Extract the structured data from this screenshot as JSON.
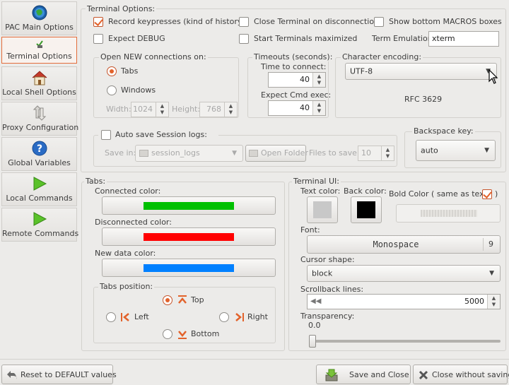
{
  "sidebar": {
    "items": [
      {
        "label": "PAC Main Options",
        "icon": "globe-icon"
      },
      {
        "label": "Terminal Options",
        "icon": "terminal-check-icon",
        "active": true
      },
      {
        "label": "Local Shell Options",
        "icon": "home-icon"
      },
      {
        "label": "Proxy Configuration",
        "icon": "proxy-arrows-icon"
      },
      {
        "label": "Global Variables",
        "icon": "help-icon"
      },
      {
        "label": "Local Commands",
        "icon": "play-icon"
      },
      {
        "label": "Remote Commands",
        "icon": "play-icon"
      }
    ]
  },
  "terminal_options": {
    "title": "Terminal Options:",
    "record_keypresses": {
      "label": "Record keypresses (kind of history)",
      "checked": true
    },
    "close_on_disconnect": {
      "label": "Close Terminal on disconnection",
      "checked": false
    },
    "show_macros": {
      "label": "Show bottom MACROS boxes",
      "checked": false
    },
    "expect_debug": {
      "label": "Expect DEBUG",
      "checked": false
    },
    "start_maximized": {
      "label": "Start Terminals maximized",
      "checked": false
    },
    "term_emulation_label": "Term Emulation:",
    "term_emulation_value": "xterm"
  },
  "open_new": {
    "title": "Open NEW connections on:",
    "tabs_label": "Tabs",
    "windows_label": "Windows",
    "selected": "Tabs",
    "width_label": "Width:",
    "width_value": "1024",
    "height_label": "Height:",
    "height_value": "768"
  },
  "timeouts": {
    "title": "Timeouts (seconds):",
    "connect_label": "Time to connect:",
    "connect_value": "40",
    "expect_label": "Expect Cmd exec:",
    "expect_value": "40"
  },
  "encoding": {
    "title": "Character encoding:",
    "value": "UTF-8",
    "description": "RFC 3629"
  },
  "session_logs": {
    "title": "Auto save Session logs:",
    "checked": false,
    "save_in_label": "Save in:",
    "folder": "session_logs",
    "open_folder": "Open Folder",
    "files_label": "Files to save:",
    "files_value": "10"
  },
  "backspace": {
    "title": "Backspace key:",
    "value": "auto"
  },
  "tabs_section": {
    "title": "Tabs:",
    "connected_label": "Connected color:",
    "connected_color": "#00c000",
    "disconnected_label": "Disconnected color:",
    "disconnected_color": "#ff0000",
    "newdata_label": "New data color:",
    "newdata_color": "#0080ff",
    "position_title": "Tabs position:",
    "top": "Top",
    "left": "Left",
    "right": "Right",
    "bottom": "Bottom",
    "selected_position": "Top"
  },
  "terminal_ui": {
    "title": "Terminal UI:",
    "text_color_label": "Text color:",
    "text_color": "#c8c8c8",
    "back_color_label": "Back color:",
    "back_color": "#000000",
    "bold_label": "Bold Color ( same as text",
    "bold_close": ")",
    "bold_checked": true,
    "font_label": "Font:",
    "font_name": "Monospace",
    "font_size": "9",
    "cursor_label": "Cursor shape:",
    "cursor_value": "block",
    "scrollback_label": "Scrollback lines:",
    "scrollback_value": "5000",
    "transparency_label": "Transparency:",
    "transparency_value": "0.0"
  },
  "footer": {
    "reset": "Reset to DEFAULT values",
    "save": "Save and Close",
    "close": "Close without saving"
  }
}
